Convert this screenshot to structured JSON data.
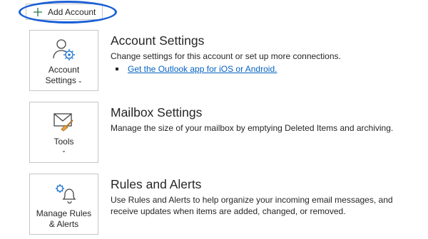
{
  "add_account": {
    "label": "Add Account",
    "icon": "plus-icon"
  },
  "tiles": [
    {
      "label_line1": "Account",
      "label_line2": "Settings",
      "icon": "person-gear-icon"
    },
    {
      "label_line1": "Tools",
      "icon": "mail-broom-icon"
    },
    {
      "label_line1": "Manage Rules",
      "label_line2": "& Alerts",
      "icon": "bell-gear-icon"
    }
  ],
  "sections": [
    {
      "title": "Account Settings",
      "desc": "Change settings for this account or set up more connections.",
      "link": "Get the Outlook app for iOS or Android."
    },
    {
      "title": "Mailbox Settings",
      "desc": "Manage the size of your mailbox by emptying Deleted Items and archiving."
    },
    {
      "title": "Rules and Alerts",
      "desc": "Use Rules and Alerts to help organize your incoming email messages, and receive updates when items are added, changed, or removed."
    }
  ],
  "colors": {
    "accent_icon": "#2b7cd3",
    "link": "#0563c1",
    "highlight": "#1a5fd6",
    "plus": "#217346"
  }
}
